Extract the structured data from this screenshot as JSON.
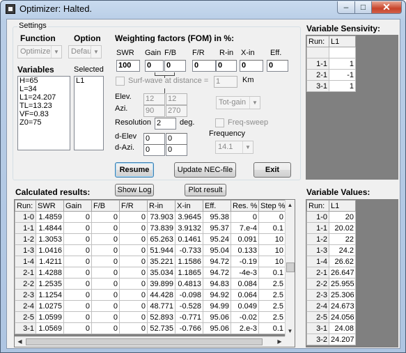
{
  "window": {
    "title": "Optimizer: Halted.",
    "min_label": "–",
    "max_label": "□",
    "close_label": "✕"
  },
  "settings": {
    "group_title": "Settings",
    "function_label": "Function",
    "function_value": "Optimize",
    "option_label": "Option",
    "option_value": "Defau",
    "variables_label": "Variables",
    "variables": [
      "H=65",
      "L=34",
      "L1=24.207",
      "TL=13.23",
      "VF=0.83",
      "Z0=75"
    ],
    "selected_label": "Selected",
    "selected": [
      "L1"
    ],
    "weighting_title": "Weighting factors (FOM) in %:",
    "weights": [
      {
        "label": "SWR",
        "value": "100"
      },
      {
        "label": "Gain",
        "value": "0"
      },
      {
        "label": "F/B",
        "value": "0"
      },
      {
        "label": "F/R",
        "value": "0"
      },
      {
        "label": "R-in",
        "value": "0"
      },
      {
        "label": "X-in",
        "value": "0"
      },
      {
        "label": "Eff.",
        "value": "0"
      }
    ],
    "surfwave_label": "Surf-wave at distance =",
    "surfwave_value": "1",
    "km_label": "Km",
    "elev_label": "Elev.",
    "azi_label": "Azi.",
    "elev_values": [
      "12",
      "12"
    ],
    "azi_values": [
      "90",
      "270"
    ],
    "gain_combo": "Tot-gain",
    "resolution_label": "Resolution",
    "resolution_value": "2",
    "deg_label": "deg.",
    "freqsweep_label": "Freq-sweep",
    "frequency_label": "Frequency",
    "frequency_value": "14.1",
    "delev_label": "d-Elev",
    "dazi_label": "d-Azi.",
    "delev_values": [
      "0",
      "0"
    ],
    "dazi_values": [
      "0",
      "0"
    ],
    "resume_label": "Resume",
    "update_label": "Update NEC-file",
    "exit_label": "Exit"
  },
  "sensivity": {
    "title": "Variable Sensivity:",
    "headers": [
      "Run:",
      "L1"
    ],
    "rows": [
      [
        "",
        ""
      ],
      [
        "1-1",
        "1"
      ],
      [
        "2-1",
        "-1"
      ],
      [
        "3-1",
        "1"
      ]
    ]
  },
  "results": {
    "title": "Calculated results:",
    "show_log_label": "Show Log",
    "plot_label": "Plot result",
    "headers": [
      "Run:",
      "SWR",
      "Gain",
      "F/B",
      "F/R",
      "R-in",
      "X-in",
      "Eff.",
      "Res. %",
      "Step %"
    ],
    "rows": [
      [
        "1-0",
        "1.4859",
        "0",
        "0",
        "0",
        "73.903",
        "3.9645",
        "95.38",
        "0",
        "0"
      ],
      [
        "1-1",
        "1.4844",
        "0",
        "0",
        "0",
        "73.839",
        "3.9132",
        "95.37",
        "7.e-4",
        "0.1"
      ],
      [
        "1-2",
        "1.3053",
        "0",
        "0",
        "0",
        "65.263",
        "0.1461",
        "95.24",
        "0.091",
        "10"
      ],
      [
        "1-3",
        "1.0416",
        "0",
        "0",
        "0",
        "51.944",
        "-0.733",
        "95.04",
        "0.133",
        "10"
      ],
      [
        "1-4",
        "1.4211",
        "0",
        "0",
        "0",
        "35.221",
        "1.1586",
        "94.72",
        "-0.19",
        "10"
      ],
      [
        "2-1",
        "1.4288",
        "0",
        "0",
        "0",
        "35.034",
        "1.1865",
        "94.72",
        "-4e-3",
        "0.1"
      ],
      [
        "2-2",
        "1.2535",
        "0",
        "0",
        "0",
        "39.899",
        "0.4813",
        "94.83",
        "0.084",
        "2.5"
      ],
      [
        "2-3",
        "1.1254",
        "0",
        "0",
        "0",
        "44.428",
        "-0.098",
        "94.92",
        "0.064",
        "2.5"
      ],
      [
        "2-4",
        "1.0275",
        "0",
        "0",
        "0",
        "48.771",
        "-0.528",
        "94.99",
        "0.049",
        "2.5"
      ],
      [
        "2-5",
        "1.0599",
        "0",
        "0",
        "0",
        "52.893",
        "-0.771",
        "95.06",
        "-0.02",
        "2.5"
      ],
      [
        "3-1",
        "1.0569",
        "0",
        "0",
        "0",
        "52.735",
        "-0.766",
        "95.06",
        "2.e-3",
        "0.1"
      ]
    ]
  },
  "values": {
    "title": "Variable Values:",
    "headers": [
      "Run:",
      "L1"
    ],
    "rows": [
      [
        "1-0",
        "20"
      ],
      [
        "1-1",
        "20.02"
      ],
      [
        "1-2",
        "22"
      ],
      [
        "1-3",
        "24.2"
      ],
      [
        "1-4",
        "26.62"
      ],
      [
        "2-1",
        "26.647"
      ],
      [
        "2-2",
        "25.955"
      ],
      [
        "2-3",
        "25.306"
      ],
      [
        "2-4",
        "24.673"
      ],
      [
        "2-5",
        "24.056"
      ],
      [
        "3-1",
        "24.08"
      ],
      [
        "3-2",
        "24.207"
      ]
    ]
  }
}
